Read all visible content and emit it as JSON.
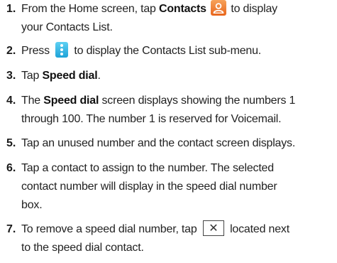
{
  "top_fragment": "",
  "steps": [
    {
      "number": "1.",
      "line1_pre": "From the Home screen, tap ",
      "line1_bold": "Contacts",
      "line1_post": " to display",
      "line2": "your Contacts List."
    },
    {
      "number": "2.",
      "line1_pre": "Press",
      "line1_post": " to display the Contacts List sub-menu."
    },
    {
      "number": "3.",
      "line1_pre": "Tap ",
      "line1_bold": "Speed dial",
      "line1_post": "."
    },
    {
      "number": "4.",
      "line1_pre": "The ",
      "line1_bold": "Speed dial",
      "line1_post": " screen displays showing the numbers 1",
      "line2": "through 100. The number 1 is reserved for Voicemail."
    },
    {
      "number": "5.",
      "line1": "Tap an unused number and the contact screen displays."
    },
    {
      "number": "6.",
      "line1": "Tap a contact to assign to the number. The selected",
      "line2": "contact number will display in the speed dial number",
      "line3": "box."
    },
    {
      "number": "7.",
      "line1_pre": "To remove a speed dial number, tap",
      "line1_post": " located next",
      "line2": "to the speed dial contact."
    }
  ],
  "icons": {
    "contacts": "contacts-person-icon",
    "menu": "menu-dots-icon",
    "remove": "close-x-icon",
    "remove_glyph": "✕"
  },
  "colors": {
    "contacts_icon": "#e8651b",
    "menu_icon": "#1ea3d8"
  }
}
